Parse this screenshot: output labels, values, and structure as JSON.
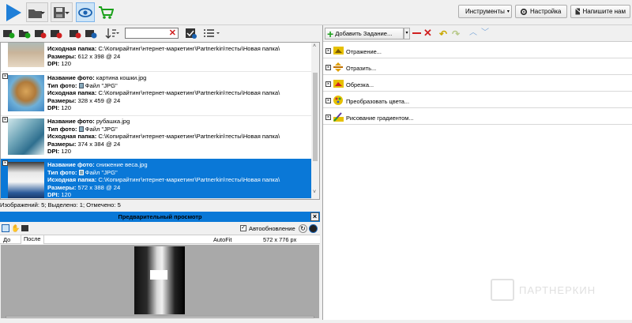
{
  "toolbar": {
    "tools_label": "Инструменты",
    "settings_label": "Настройка",
    "write_label": "Напишите нам"
  },
  "search": {
    "value": ""
  },
  "files": [
    {
      "name_label": "",
      "name": "",
      "type_label": "",
      "type": "",
      "src_label": "Исходная папка:",
      "src": "C:\\Копирайтинг\\нтернет-маркетинг\\Partnerkin\\тесты\\Новая папка\\",
      "size_label": "Размеры:",
      "size": "612 x 398 @ 24",
      "dpi_label": "DPI:",
      "dpi": "120"
    },
    {
      "name_label": "Название фото:",
      "name": "картина кошки.jpg",
      "type_label": "Тип фото:",
      "type": "Файл \"JPG\"",
      "src_label": "Исходная папка:",
      "src": "C:\\Копирайтинг\\нтернет-маркетинг\\Partnerkin\\тесты\\Новая папка\\",
      "size_label": "Размеры:",
      "size": "328 x 459 @ 24",
      "dpi_label": "DPI:",
      "dpi": "120"
    },
    {
      "name_label": "Название фото:",
      "name": "рубашка.jpg",
      "type_label": "Тип фото:",
      "type": "Файл \"JPG\"",
      "src_label": "Исходная папка:",
      "src": "C:\\Копирайтинг\\нтернет-маркетинг\\Partnerkin\\тесты\\Новая папка\\",
      "size_label": "Размеры:",
      "size": "374 x 384 @ 24",
      "dpi_label": "DPI:",
      "dpi": "120"
    },
    {
      "name_label": "Название фото:",
      "name": "снижение веса.jpg",
      "type_label": "Тип фото:",
      "type": "Файл \"JPG\"",
      "src_label": "Исходная папка:",
      "src": "C:\\Копирайтинг\\нтернет-маркетинг\\Partnerkin\\тесты\\Новая папка\\",
      "size_label": "Размеры:",
      "size": "572 x 388 @ 24",
      "dpi_label": "DPI:",
      "dpi": "120"
    }
  ],
  "status": "Изображений: 5; Выделено: 1; Отмечено: 5",
  "preview": {
    "title": "Предварительный просмотр",
    "auto_update": "Автообновление",
    "tab_before": "До",
    "tab_after": "После",
    "autofit": "AutoFit",
    "dims": "572 x 776 px"
  },
  "tasks_toolbar": {
    "add_label": "Добавить Задание..."
  },
  "tasks": [
    {
      "label": "Отражение..."
    },
    {
      "label": "Отразить..."
    },
    {
      "label": "Обрезка..."
    },
    {
      "label": "Преобразовать цвета..."
    },
    {
      "label": "Рисование градиентом..."
    }
  ],
  "watermark": "ПАРТНЕРКИН",
  "colors": {
    "accent": "#0a78d7",
    "preview_bg": "#a9a9a9"
  }
}
